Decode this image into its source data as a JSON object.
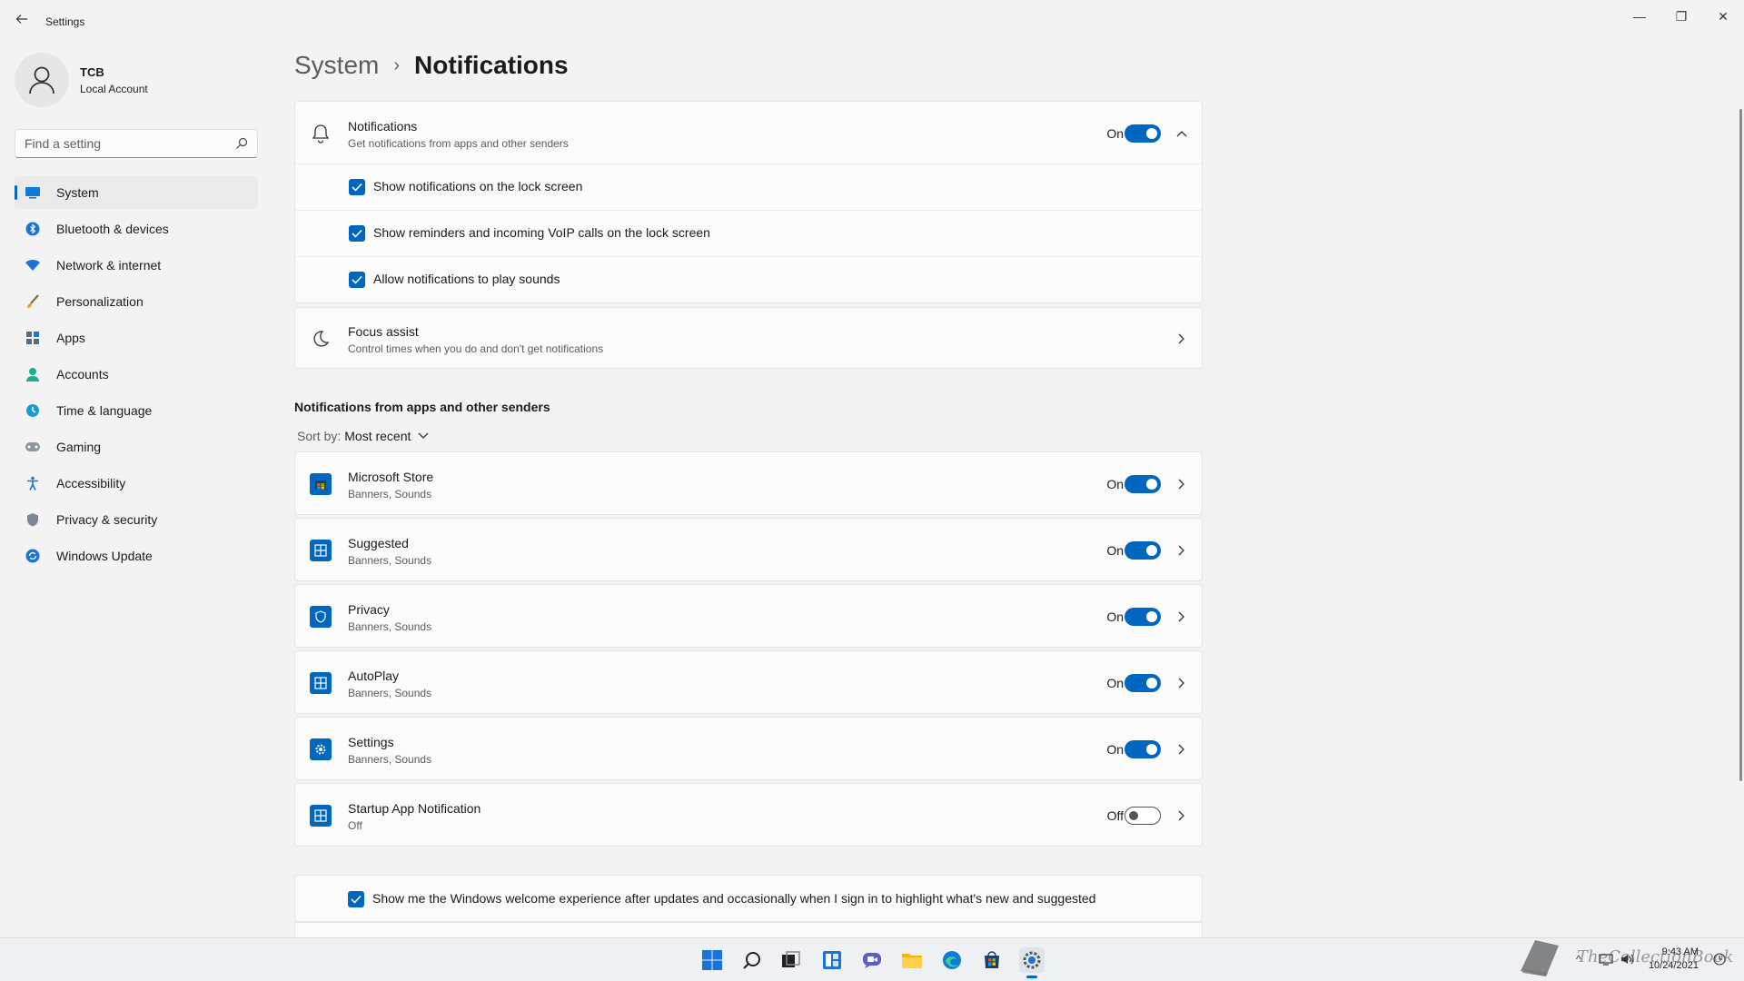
{
  "window": {
    "title": "Settings",
    "controls": {
      "minimize": "—",
      "maximize": "❐",
      "close": "✕"
    }
  },
  "profile": {
    "name": "TCB",
    "account_type": "Local Account"
  },
  "search": {
    "placeholder": "Find a setting"
  },
  "nav": {
    "items": [
      {
        "label": "System",
        "icon": "system-icon",
        "active": true
      },
      {
        "label": "Bluetooth & devices",
        "icon": "bluetooth-icon"
      },
      {
        "label": "Network & internet",
        "icon": "wifi-icon"
      },
      {
        "label": "Personalization",
        "icon": "brush-icon"
      },
      {
        "label": "Apps",
        "icon": "apps-icon"
      },
      {
        "label": "Accounts",
        "icon": "person-icon"
      },
      {
        "label": "Time & language",
        "icon": "globe-clock-icon"
      },
      {
        "label": "Gaming",
        "icon": "gamepad-icon"
      },
      {
        "label": "Accessibility",
        "icon": "accessibility-icon"
      },
      {
        "label": "Privacy & security",
        "icon": "shield-icon"
      },
      {
        "label": "Windows Update",
        "icon": "update-icon"
      }
    ]
  },
  "breadcrumb": {
    "parent": "System",
    "separator": "›",
    "current": "Notifications"
  },
  "notifications": {
    "title": "Notifications",
    "subtitle": "Get notifications from apps and other senders",
    "state": "On",
    "options": [
      {
        "label": "Show notifications on the lock screen",
        "checked": true
      },
      {
        "label": "Show reminders and incoming VoIP calls on the lock screen",
        "checked": true
      },
      {
        "label": "Allow notifications to play sounds",
        "checked": true
      }
    ]
  },
  "focus_assist": {
    "title": "Focus assist",
    "subtitle": "Control times when you do and don't get notifications"
  },
  "apps_section": {
    "title": "Notifications from apps and other senders",
    "sort_label": "Sort by:",
    "sort_value": "Most recent",
    "apps": [
      {
        "name": "Microsoft Store",
        "detail": "Banners, Sounds",
        "state": "On",
        "on": true,
        "icon": "store-icon"
      },
      {
        "name": "Suggested",
        "detail": "Banners, Sounds",
        "state": "On",
        "on": true,
        "icon": "app-grid-icon"
      },
      {
        "name": "Privacy",
        "detail": "Banners, Sounds",
        "state": "On",
        "on": true,
        "icon": "shield-icon"
      },
      {
        "name": "AutoPlay",
        "detail": "Banners, Sounds",
        "state": "On",
        "on": true,
        "icon": "app-grid-icon"
      },
      {
        "name": "Settings",
        "detail": "Banners, Sounds",
        "state": "On",
        "on": true,
        "icon": "gear-icon"
      },
      {
        "name": "Startup App Notification",
        "detail": "Off",
        "state": "Off",
        "on": false,
        "icon": "app-grid-icon"
      }
    ]
  },
  "welcome": {
    "label": "Show me the Windows welcome experience after updates and occasionally when I sign in to highlight what's new and suggested",
    "checked": true
  },
  "taskbar": {
    "clock_time": "9:43 AM",
    "clock_date": "10/24/2021",
    "watermark": "TheCollectionBook"
  },
  "colors": {
    "accent": "#0067c0",
    "background": "#f3f3f3",
    "card": "#fbfbfb"
  }
}
